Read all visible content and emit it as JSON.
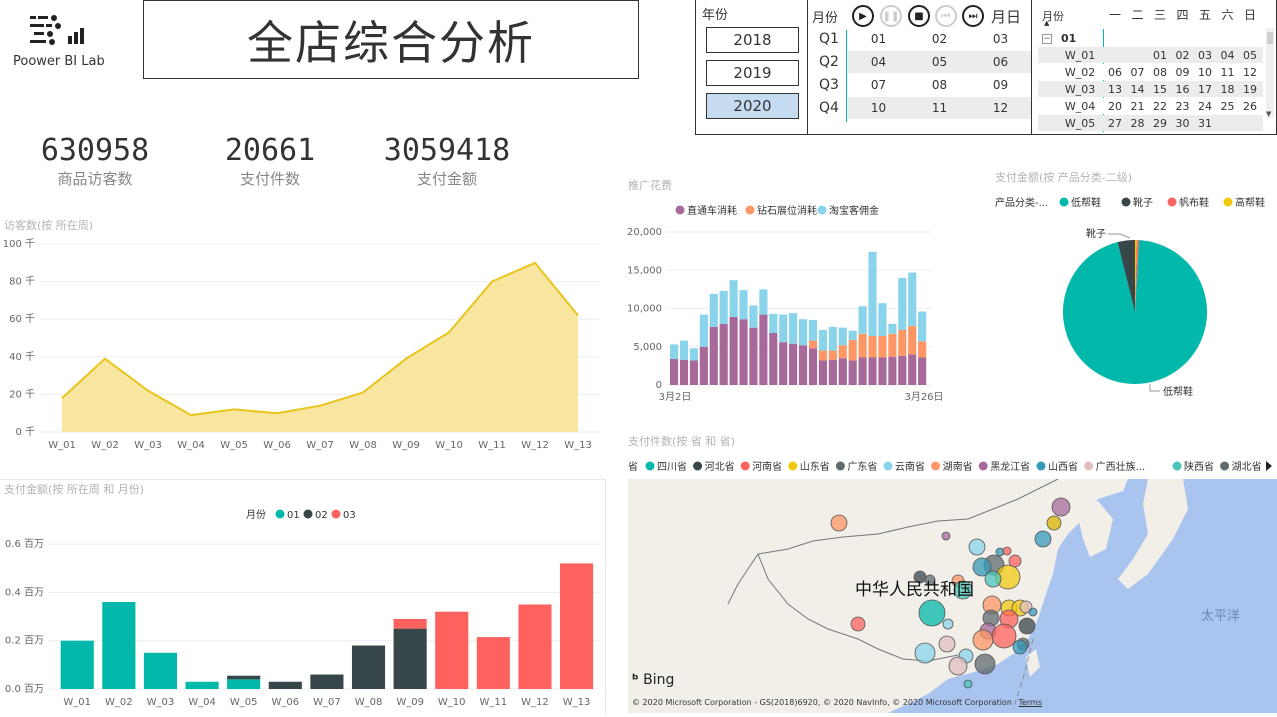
{
  "logo": {
    "name": "Poower BI Lab"
  },
  "header": {
    "title": "全店综合分析"
  },
  "year_slicer": {
    "title": "年份",
    "options": [
      "2018",
      "2019",
      "2020"
    ],
    "selected": "2020"
  },
  "month_slicer": {
    "title": "月份",
    "end_label": "月日",
    "quarters": [
      {
        "label": "Q1",
        "months": [
          "01",
          "02",
          "03"
        ]
      },
      {
        "label": "Q2",
        "months": [
          "04",
          "05",
          "06"
        ]
      },
      {
        "label": "Q3",
        "months": [
          "07",
          "08",
          "09"
        ]
      },
      {
        "label": "Q4",
        "months": [
          "10",
          "11",
          "12"
        ]
      }
    ]
  },
  "calendar": {
    "title": "月份",
    "weekdays": [
      "一",
      "二",
      "三",
      "四",
      "五",
      "六",
      "日"
    ],
    "month": "01",
    "weeks": [
      {
        "label": "W_01",
        "days": [
          "",
          "",
          "01",
          "02",
          "03",
          "04",
          "05"
        ]
      },
      {
        "label": "W_02",
        "days": [
          "06",
          "07",
          "08",
          "09",
          "10",
          "11",
          "12"
        ]
      },
      {
        "label": "W_03",
        "days": [
          "13",
          "14",
          "15",
          "16",
          "17",
          "18",
          "19"
        ]
      },
      {
        "label": "W_04",
        "days": [
          "20",
          "21",
          "22",
          "23",
          "24",
          "25",
          "26"
        ]
      },
      {
        "label": "W_05",
        "days": [
          "27",
          "28",
          "29",
          "30",
          "31",
          "",
          ""
        ]
      }
    ]
  },
  "kpis": [
    {
      "value": "630958",
      "label": "商品访客数"
    },
    {
      "value": "20661",
      "label": "支付件数"
    },
    {
      "value": "3059418",
      "label": "支付金额"
    }
  ],
  "colors": {
    "teal": "#01b8aa",
    "dark": "#374649",
    "red": "#fd625e",
    "yellow": "#f2c80f",
    "purple": "#a66999",
    "orange": "#fe9666",
    "skyblue": "#8ad4eb",
    "area_fill": "#f8e49a",
    "area_line": "#e8c41c"
  },
  "visitors_chart": {
    "title": "访客数(按 所在周)",
    "chart_data": {
      "type": "area",
      "categories": [
        "W_01",
        "W_02",
        "W_03",
        "W_04",
        "W_05",
        "W_06",
        "W_07",
        "W_08",
        "W_09",
        "W_10",
        "W_11",
        "W_12",
        "W_13"
      ],
      "values": [
        18,
        39,
        22,
        9,
        12,
        10,
        14,
        21,
        39,
        53,
        80,
        90,
        62
      ],
      "unit": "千",
      "ylim": [
        0,
        100
      ],
      "yticks": [
        "0 千",
        "20 千",
        "40 千",
        "60 千",
        "80 千",
        "100 千"
      ]
    }
  },
  "payment_chart": {
    "title": "支付金额(按 所在周 和 月份)",
    "legend_title": "月份",
    "chart_data": {
      "type": "bar",
      "stacked": true,
      "categories": [
        "W_01",
        "W_02",
        "W_03",
        "W_04",
        "W_05",
        "W_06",
        "W_07",
        "W_08",
        "W_09",
        "W_10",
        "W_11",
        "W_12",
        "W_13"
      ],
      "series": [
        {
          "name": "01",
          "values": [
            0.2,
            0.36,
            0.15,
            0.03,
            0.04,
            0,
            0,
            0,
            0,
            0,
            0,
            0,
            0
          ]
        },
        {
          "name": "02",
          "values": [
            0,
            0,
            0,
            0,
            0.015,
            0.03,
            0.06,
            0.18,
            0.25,
            0,
            0,
            0,
            0
          ]
        },
        {
          "name": "03",
          "values": [
            0,
            0,
            0,
            0,
            0,
            0,
            0,
            0,
            0.04,
            0.32,
            0.215,
            0.35,
            0.52
          ]
        }
      ],
      "ylim": [
        0,
        0.65
      ],
      "yticks": [
        "0.0 百万",
        "0.2 百万",
        "0.4 百万",
        "0.6 百万"
      ]
    }
  },
  "promo_chart": {
    "title": "推广花费",
    "chart_data": {
      "type": "bar",
      "stacked": true,
      "x_start_label": "3月2日",
      "x_end_label": "3月26日",
      "series": [
        {
          "name": "直通车消耗",
          "values": [
            3400,
            3300,
            3200,
            5000,
            7600,
            8000,
            8900,
            8600,
            7500,
            9200,
            6800,
            5600,
            5400,
            5200,
            4800,
            3200,
            3300,
            3500,
            3200,
            3600,
            3600,
            3600,
            3700,
            3800,
            4000,
            3600
          ]
        },
        {
          "name": "钻石展位消耗",
          "values": [
            0,
            0,
            0,
            0,
            0,
            0,
            0,
            0,
            0,
            0,
            0,
            0,
            0,
            0,
            1000,
            1300,
            1200,
            1700,
            2700,
            3100,
            2800,
            2800,
            3000,
            3400,
            3700,
            2100
          ]
        },
        {
          "name": "淘宝客佣金",
          "values": [
            1900,
            2500,
            1600,
            4200,
            4300,
            4300,
            4800,
            3800,
            2900,
            3300,
            2500,
            3600,
            4000,
            3400,
            2700,
            2700,
            3100,
            2300,
            1200,
            3600,
            11000,
            4300,
            1300,
            6800,
            7000,
            3900
          ]
        }
      ],
      "ylim": [
        0,
        20000
      ],
      "yticks": [
        "0",
        "5,000",
        "10,000",
        "15,000",
        "20,000"
      ]
    }
  },
  "pie_chart": {
    "title": "支付金额(按 产品分类-二级)",
    "legend_title": "产品分类-...",
    "chart_data": {
      "type": "pie",
      "labels": [
        "低帮鞋",
        "靴子",
        "帆布鞋",
        "高帮鞋"
      ],
      "values": [
        95.2,
        3.9,
        0.5,
        0.4
      ],
      "slice_labels": [
        "低帮鞋",
        "靴子"
      ]
    }
  },
  "map_panel": {
    "title": "支付件数(按 省 和 省)",
    "legend_title": "省",
    "legend": [
      {
        "name": "四川省",
        "color": "#01b8aa"
      },
      {
        "name": "河北省",
        "color": "#374649"
      },
      {
        "name": "河南省",
        "color": "#fd625e"
      },
      {
        "name": "山东省",
        "color": "#f2c80f"
      },
      {
        "name": "广东省",
        "color": "#5f6b6d"
      },
      {
        "name": "云南省",
        "color": "#8ad4eb"
      },
      {
        "name": "湖南省",
        "color": "#fe9666"
      },
      {
        "name": "黑龙江省",
        "color": "#a66999"
      },
      {
        "name": "山西省",
        "color": "#3599b8"
      },
      {
        "name": "广西壮族...",
        "color": "#dfbfbf"
      },
      {
        "name": "陕西省",
        "color": "#4ac5bb"
      },
      {
        "name": "湖北省",
        "color": "#5f6b6d"
      }
    ],
    "country_label": "中华人民共和国",
    "ocean_label": "太平洋",
    "bing_label": "Bing",
    "attribution": "© 2020 Microsoft Corporation - GS(2018)6920, © 2020 NavInfo, © 2020 Microsoft Corporation",
    "terms": "Terms"
  }
}
